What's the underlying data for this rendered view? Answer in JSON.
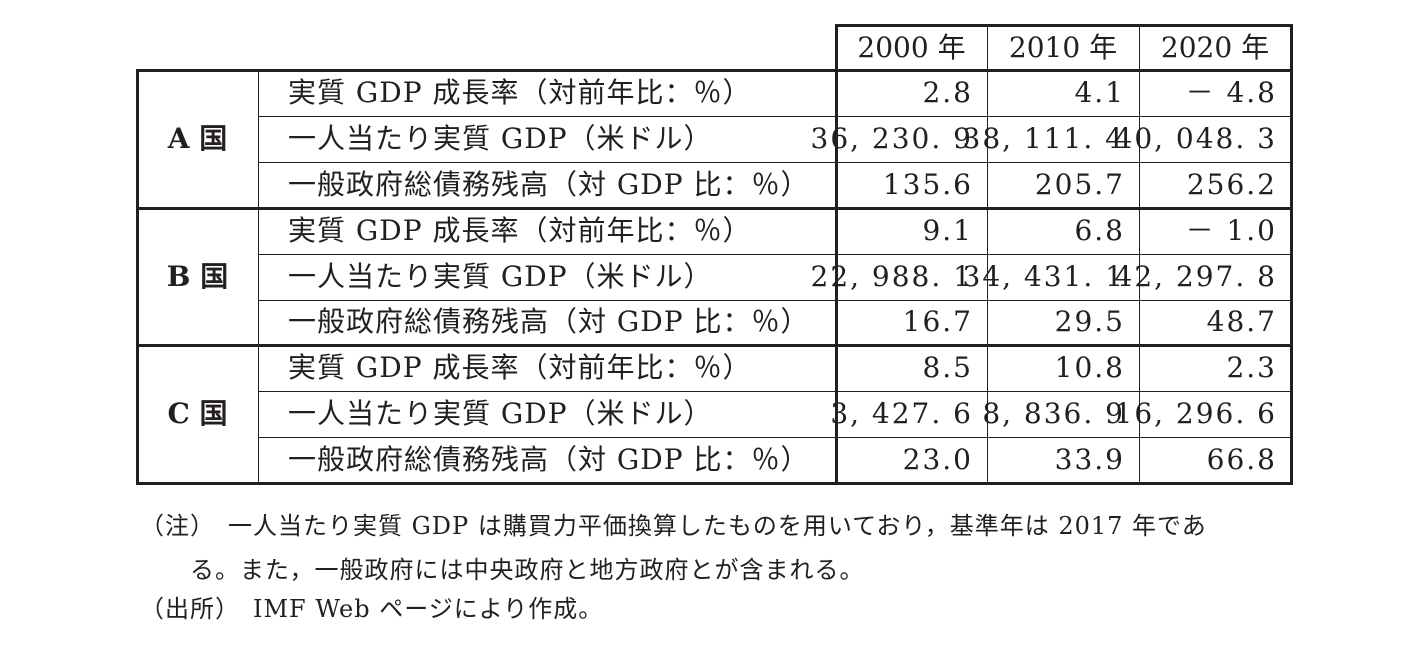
{
  "table": {
    "years": [
      "2000 年",
      "2010 年",
      "2020 年"
    ],
    "groups": [
      {
        "country": "A 国",
        "rows": [
          {
            "label": "実質 GDP 成長率（対前年比：％）",
            "values": [
              "2.8",
              "4.1",
              "－ 4.8"
            ]
          },
          {
            "label": "一人当たり実質 GDP（米ドル）",
            "values": [
              "36, 230. 9",
              "38, 111. 4",
              "40, 048. 3"
            ]
          },
          {
            "label": "一般政府総債務残高（対 GDP 比：％）",
            "values": [
              "135.6",
              "205.7",
              "256.2"
            ]
          }
        ]
      },
      {
        "country": "B 国",
        "rows": [
          {
            "label": "実質 GDP 成長率（対前年比：％）",
            "values": [
              "9.1",
              "6.8",
              "－ 1.0"
            ]
          },
          {
            "label": "一人当たり実質 GDP（米ドル）",
            "values": [
              "22, 988. 1",
              "34, 431. 1",
              "42, 297. 8"
            ]
          },
          {
            "label": "一般政府総債務残高（対 GDP 比：％）",
            "values": [
              "16.7",
              "29.5",
              "48.7"
            ]
          }
        ]
      },
      {
        "country": "C 国",
        "rows": [
          {
            "label": "実質 GDP 成長率（対前年比：％）",
            "values": [
              "8.5",
              "10.8",
              "2.3"
            ]
          },
          {
            "label": "一人当たり実質 GDP（米ドル）",
            "values": [
              "3, 427. 6",
              "8, 836. 9",
              "16, 296. 6"
            ]
          },
          {
            "label": "一般政府総債務残高（対 GDP 比：％）",
            "values": [
              "23.0",
              "33.9",
              "66.8"
            ]
          }
        ]
      }
    ]
  },
  "notes": {
    "note_line1": "（注）　一人当たり実質 GDP は購買力平価換算したものを用いており，基準年は 2017 年であ",
    "note_line2": "る。また，一般政府には中央政府と地方政府とが含まれる。",
    "source_line": "（出所）　IMF Web ページにより作成。"
  }
}
